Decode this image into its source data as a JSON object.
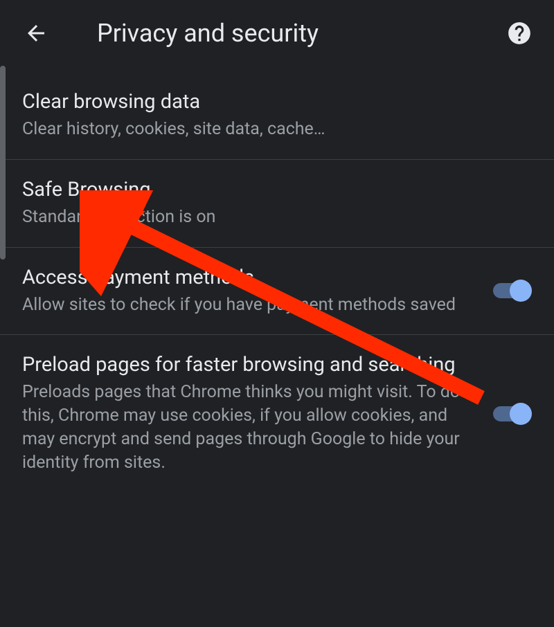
{
  "header": {
    "title": "Privacy and security"
  },
  "settings": {
    "clear_browsing": {
      "title": "Clear browsing data",
      "subtitle": "Clear history, cookies, site data, cache…"
    },
    "safe_browsing": {
      "title": "Safe Browsing",
      "subtitle": "Standard protection is on"
    },
    "payment_methods": {
      "title": "Access payment methods",
      "subtitle": "Allow sites to check if you have payment methods saved"
    },
    "preload": {
      "title": "Preload pages for faster browsing and searching",
      "subtitle": "Preloads pages that Chrome thinks you might visit. To do this, Chrome may use cookies, if you allow cookies, and may encrypt and send pages through Google to hide your identity from sites."
    }
  }
}
